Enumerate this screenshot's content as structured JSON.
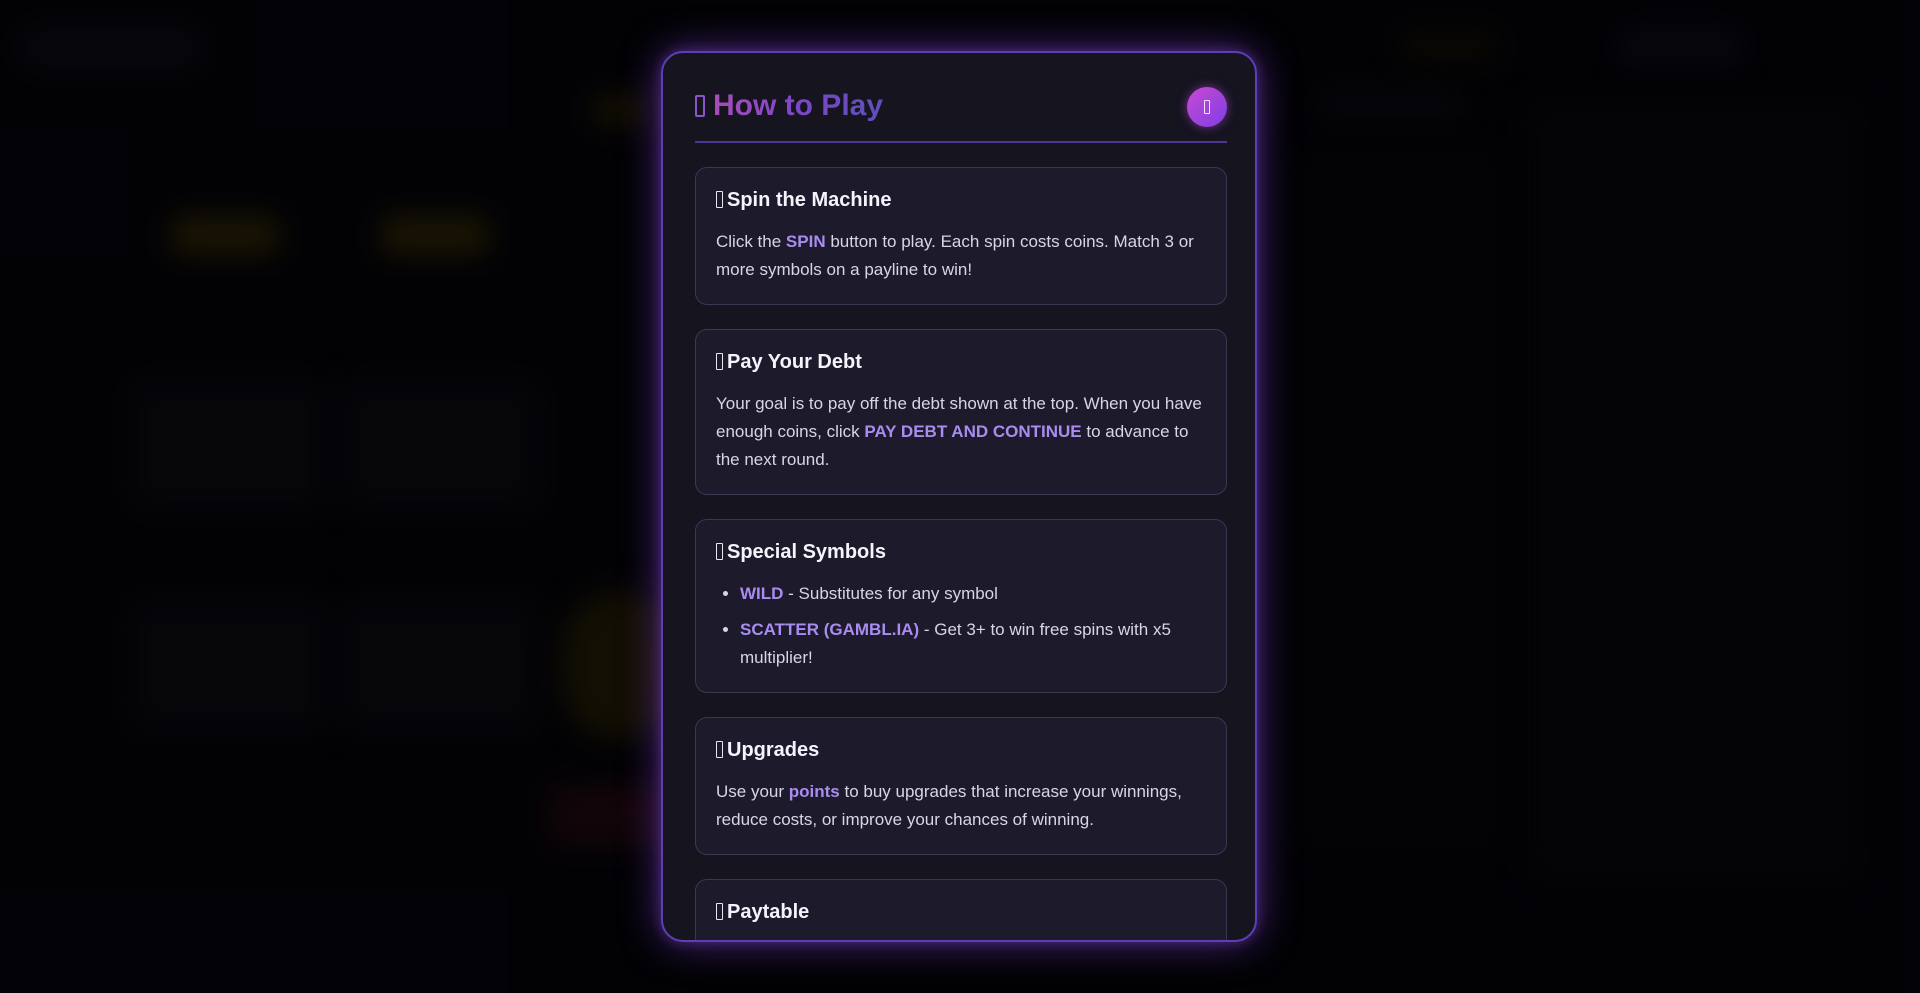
{
  "modal": {
    "title": "How to Play",
    "title_icon": "book-icon",
    "close_icon": "close-icon"
  },
  "sections": {
    "spin": {
      "icon": "slot-icon",
      "title": "Spin the Machine",
      "text_pre": "Click the ",
      "text_hl": "SPIN",
      "text_post": " button to play. Each spin costs coins. Match 3 or more symbols on a payline to win!"
    },
    "debt": {
      "icon": "money-icon",
      "title": "Pay Your Debt",
      "text_pre": "Your goal is to pay off the debt shown at the top. When you have enough coins, click ",
      "text_hl": "PAY DEBT AND CONTINUE",
      "text_post": " to advance to the next round."
    },
    "symbols": {
      "icon": "star-icon",
      "title": "Special Symbols",
      "items": [
        {
          "name": "WILD",
          "desc": " - Substitutes for any symbol"
        },
        {
          "name": "SCATTER (GAMBL.IA)",
          "desc": " - Get 3+ to win free spins with x5 multiplier!"
        }
      ]
    },
    "upgrades": {
      "icon": "arrow-up-icon",
      "title": "Upgrades",
      "text_pre": "Use your ",
      "text_hl": "points",
      "text_post": " to buy upgrades that increase your winnings, reduce costs, or improve your chances of winning."
    },
    "paytable": {
      "icon": "table-icon",
      "title": "Paytable"
    }
  },
  "colors": {
    "accent": "#a98cf0",
    "modal_border": "#5b3fb3",
    "close_gradient_start": "#c94ad2",
    "close_gradient_end": "#7f3de6"
  }
}
